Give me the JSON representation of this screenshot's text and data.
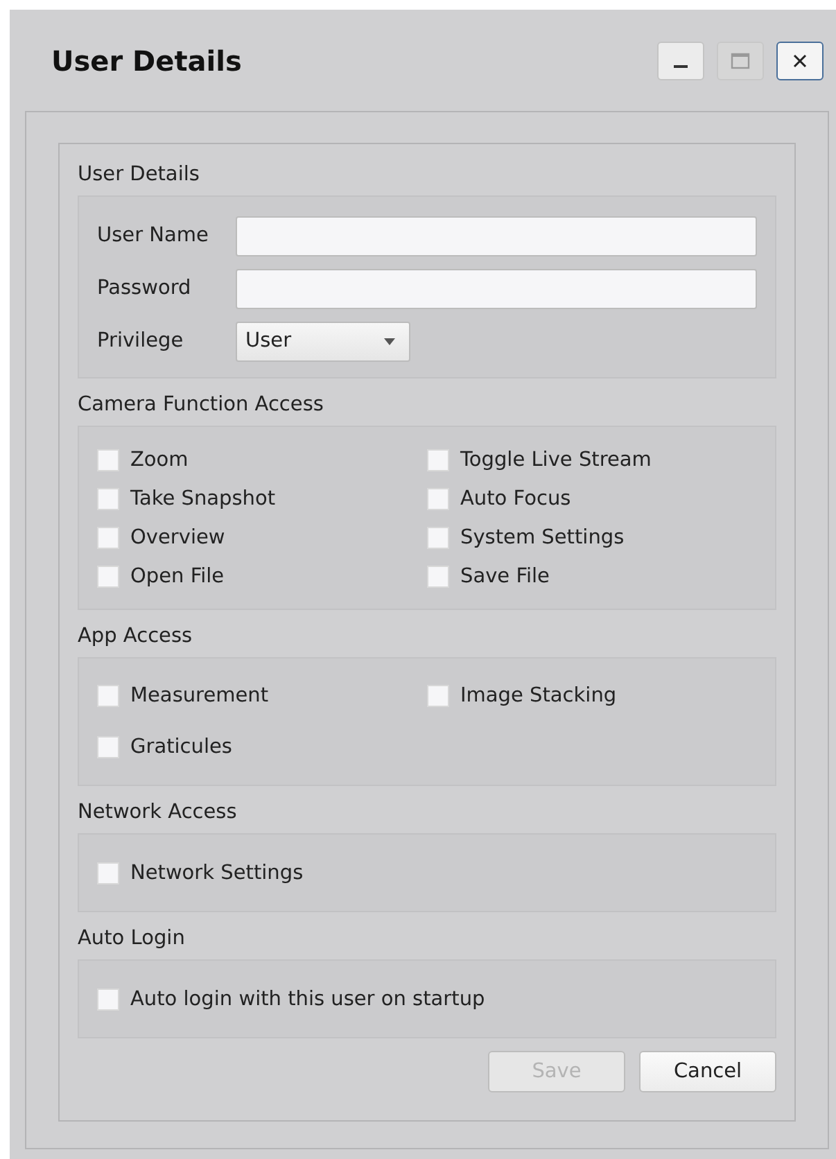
{
  "window": {
    "title": "User Details",
    "controls": [
      {
        "kind": "minimize",
        "disabled": false
      },
      {
        "kind": "maximize",
        "disabled": true
      },
      {
        "kind": "close",
        "disabled": false
      }
    ]
  },
  "sections": [
    {
      "kind": "fields",
      "label": "User Details",
      "fields": [
        {
          "kind": "text",
          "label": "User Name"
        },
        {
          "kind": "password",
          "label": "Password"
        },
        {
          "kind": "select",
          "label": "Privilege",
          "value": "User"
        }
      ]
    },
    {
      "kind": "checks",
      "label": "Camera Function Access",
      "items": [
        {
          "label": "Zoom",
          "checked": false
        },
        {
          "label": "Toggle Live Stream",
          "checked": false
        },
        {
          "label": "Take Snapshot",
          "checked": false
        },
        {
          "label": "Auto Focus",
          "checked": false
        },
        {
          "label": "Overview",
          "checked": false
        },
        {
          "label": "System Settings",
          "checked": false
        },
        {
          "label": "Open File",
          "checked": false
        },
        {
          "label": "Save File",
          "checked": false
        }
      ]
    },
    {
      "kind": "checks",
      "label": "App Access",
      "items": [
        {
          "label": "Measurement",
          "checked": false
        },
        {
          "label": "Image Stacking",
          "checked": false
        },
        {
          "label": "Graticules",
          "checked": false
        }
      ]
    },
    {
      "kind": "checks",
      "label": "Network Access",
      "items": [
        {
          "label": "Network Settings",
          "checked": false
        }
      ]
    },
    {
      "kind": "checks",
      "label": "Auto Login",
      "items": [
        {
          "label": "Auto login with this user on startup",
          "checked": false
        }
      ]
    }
  ],
  "buttons": [
    {
      "label": "Save",
      "disabled": true
    },
    {
      "label": "Cancel",
      "disabled": false
    }
  ]
}
